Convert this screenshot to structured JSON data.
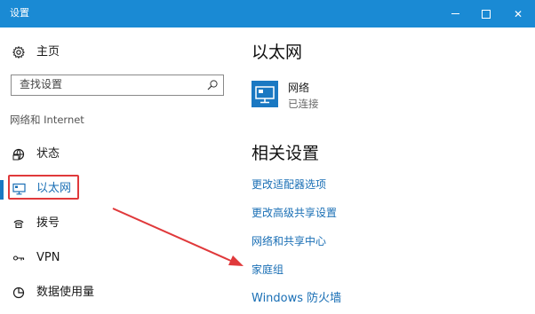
{
  "window": {
    "title": "设置"
  },
  "titlebar": {
    "minimize_icon": "minimize-icon",
    "maximize_icon": "maximize-icon",
    "close_icon": "close-icon",
    "close_glyph": "✕",
    "color": "#1a8ad4"
  },
  "sidebar": {
    "home_label": "主页",
    "search_placeholder": "查找设置",
    "section_label": "网络和 Internet",
    "items": [
      {
        "label": "状态",
        "icon": "globe-status-icon"
      },
      {
        "label": "以太网",
        "icon": "ethernet-monitor-icon",
        "active": true
      },
      {
        "label": "拨号",
        "icon": "dialup-phone-icon"
      },
      {
        "label": "VPN",
        "icon": "vpn-icon"
      },
      {
        "label": "数据使用量",
        "icon": "data-usage-icon"
      }
    ],
    "accent_color": "#1a78c2",
    "highlight_color": "#e0393b"
  },
  "main": {
    "title": "以太网",
    "network": {
      "name": "网络",
      "status": "已连接",
      "icon": "ethernet-monitor-icon"
    },
    "related_title": "相关设置",
    "links": [
      "更改适配器选项",
      "更改高级共享设置",
      "网络和共享中心",
      "家庭组",
      "Windows 防火墙"
    ],
    "link_color": "#1a6fb5"
  },
  "annotation": {
    "arrow_color": "#e0393b"
  }
}
